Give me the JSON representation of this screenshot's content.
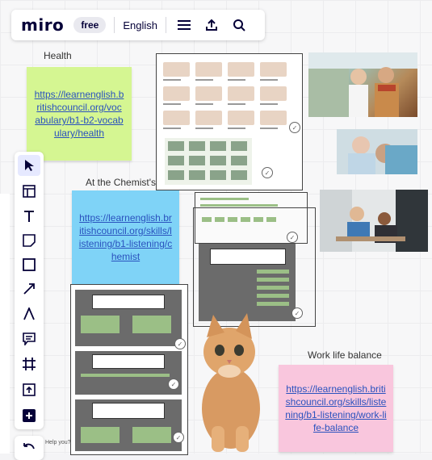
{
  "toolbar": {
    "logo": "miro",
    "plan": "free",
    "board_name": "English",
    "icons": [
      "menu-icon",
      "upload-icon",
      "search-icon"
    ]
  },
  "labels": {
    "health": "Health",
    "chemist": "At the Chemist's",
    "worklife": "Work life balance"
  },
  "stickies": {
    "health_link": "https://learnenglish.britishcouncil.org/vocabulary/b1-b2-vocabulary/health",
    "chemist_link": "https://learnenglish.britishcouncil.org/skills/listening/b1-listening/chemist",
    "worklife_link": "https://learnenglish.britishcouncil.org/skills/listening/b1-listening/work-life-balance"
  },
  "left_tools": [
    "select-icon",
    "template-icon",
    "text-icon",
    "sticky-note-icon",
    "shape-icon",
    "connector-icon",
    "pen-icon",
    "comment-icon",
    "frame-icon",
    "upload-icon",
    "add-icon"
  ],
  "colors": {
    "green_sticky": "#d5f692",
    "blue_sticky": "#7fd3f7",
    "pink_sticky": "#f9c6dd",
    "accent": "#4262ff"
  },
  "help_text": "Help you?"
}
